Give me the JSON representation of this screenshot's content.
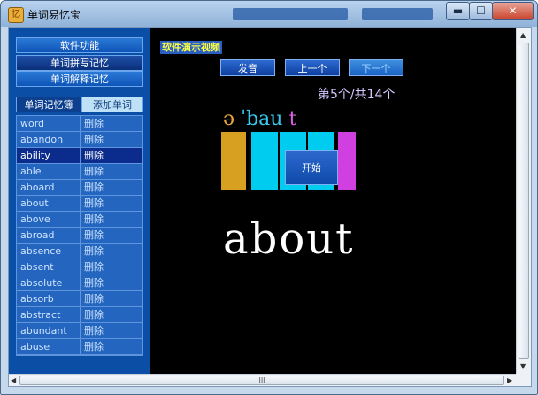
{
  "window": {
    "title": "单词易忆宝",
    "app_icon_glyph": "忆",
    "minimize_glyph": "▬",
    "maximize_glyph": "☐",
    "close_glyph": "✕"
  },
  "sidebar": {
    "menu_title": "软件功能",
    "menu_items": [
      "单词拼写记忆",
      "单词解释记忆"
    ],
    "tabs": {
      "notebook": "单词记忆簿",
      "add": "添加单词"
    },
    "word_rows": [
      {
        "word": "word",
        "action": "删除",
        "selected": false
      },
      {
        "word": "abandon",
        "action": "删除",
        "selected": false
      },
      {
        "word": "ability",
        "action": "删除",
        "selected": true
      },
      {
        "word": "able",
        "action": "删除",
        "selected": false
      },
      {
        "word": "aboard",
        "action": "删除",
        "selected": false
      },
      {
        "word": "about",
        "action": "删除",
        "selected": false
      },
      {
        "word": "above",
        "action": "删除",
        "selected": false
      },
      {
        "word": "abroad",
        "action": "删除",
        "selected": false
      },
      {
        "word": "absence",
        "action": "删除",
        "selected": false
      },
      {
        "word": "absent",
        "action": "删除",
        "selected": false
      },
      {
        "word": "absolute",
        "action": "删除",
        "selected": false
      },
      {
        "word": "absorb",
        "action": "删除",
        "selected": false
      },
      {
        "word": "abstract",
        "action": "删除",
        "selected": false
      },
      {
        "word": "abundant",
        "action": "删除",
        "selected": false
      },
      {
        "word": "abuse",
        "action": "删除",
        "selected": false
      }
    ]
  },
  "main": {
    "video_label": "软件演示视频",
    "buttons": {
      "pronounce": "发音",
      "prev": "上一个",
      "next": "下一个",
      "start": "开始"
    },
    "counter": "第5个/共14个",
    "phonetic": [
      {
        "text": "ə ",
        "color": "#e8a838"
      },
      {
        "text": "ˈbau ",
        "color": "#38c8ee"
      },
      {
        "text": "t",
        "color": "#e060e8"
      }
    ],
    "syllable_colors": [
      "#d8a020",
      "#00ccf0",
      "#00ccf0",
      "#00ccf0",
      "#d040e0"
    ],
    "word": "about"
  },
  "scrollbar": {
    "grip": "III",
    "up": "▲",
    "down": "▼",
    "left": "◀",
    "right": "▶"
  }
}
